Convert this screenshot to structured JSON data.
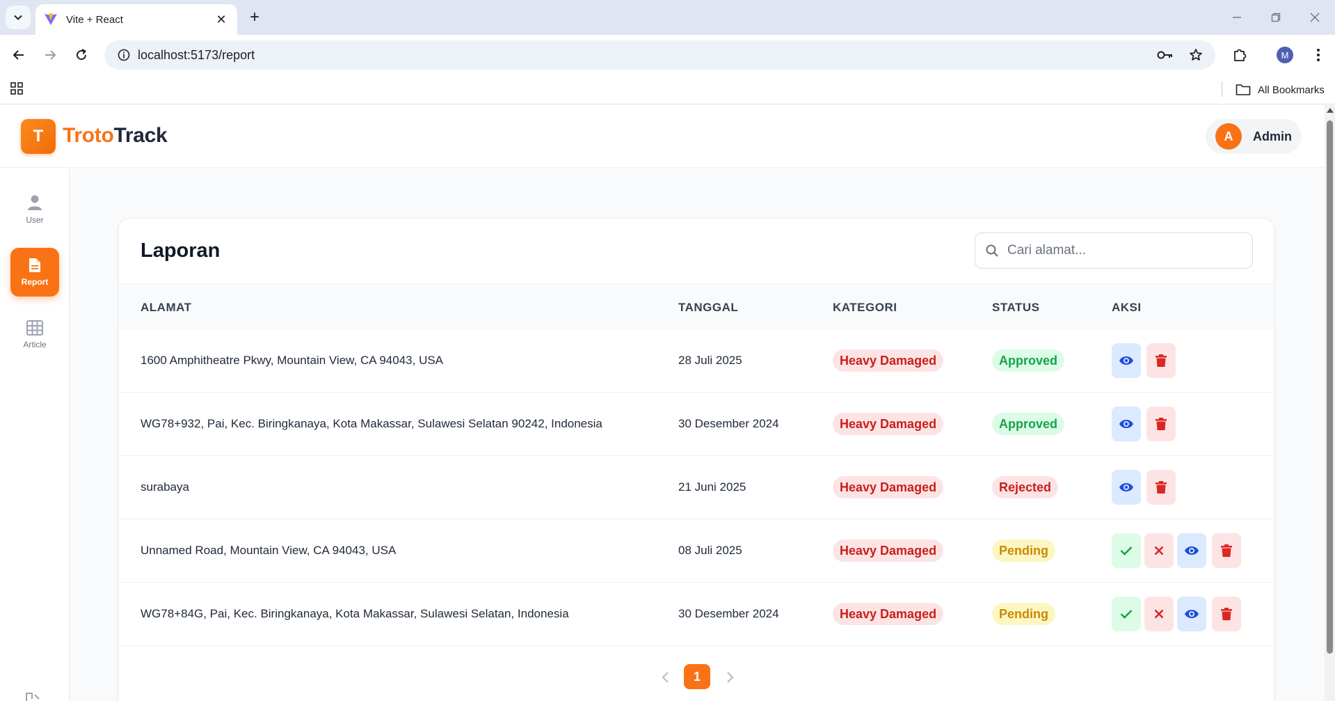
{
  "browser": {
    "tab_title": "Vite + React",
    "url": "localhost:5173/report",
    "bookmarks_label": "All Bookmarks",
    "profile_initial": "M"
  },
  "app": {
    "logo_letter": "T",
    "logo_part1": "Troto",
    "logo_part2": "Track",
    "user_initial": "A",
    "user_name": "Admin"
  },
  "sidebar": {
    "items": [
      {
        "label": "User",
        "icon": "user-icon"
      },
      {
        "label": "Report",
        "icon": "document-icon",
        "active": true
      },
      {
        "label": "Article",
        "icon": "grid-icon"
      }
    ]
  },
  "report": {
    "title": "Laporan",
    "search_placeholder": "Cari alamat...",
    "columns": [
      "ALAMAT",
      "TANGGAL",
      "KATEGORI",
      "STATUS",
      "AKSI"
    ],
    "rows": [
      {
        "alamat": "1600 Amphitheatre Pkwy, Mountain View, CA 94043, USA",
        "tanggal": "28 Juli 2025",
        "kategori": "Heavy Damaged",
        "status": "Approved"
      },
      {
        "alamat": "WG78+932, Pai, Kec. Biringkanaya, Kota Makassar, Sulawesi Selatan 90242, Indonesia",
        "tanggal": "30 Desember 2024",
        "kategori": "Heavy Damaged",
        "status": "Approved"
      },
      {
        "alamat": "surabaya",
        "tanggal": "21 Juni 2025",
        "kategori": "Heavy Damaged",
        "status": "Rejected"
      },
      {
        "alamat": "Unnamed Road, Mountain View, CA 94043, USA",
        "tanggal": "08 Juli 2025",
        "kategori": "Heavy Damaged",
        "status": "Pending"
      },
      {
        "alamat": "WG78+84G, Pai, Kec. Biringkanaya, Kota Makassar, Sulawesi Selatan, Indonesia",
        "tanggal": "30 Desember 2024",
        "kategori": "Heavy Damaged",
        "status": "Pending"
      }
    ],
    "pagination": {
      "current_page": "1"
    }
  },
  "colors": {
    "accent": "#f97316",
    "approved": "#16a34a",
    "rejected": "#c81e1e",
    "pending": "#ca8a04",
    "view": "#1d4ed8"
  }
}
